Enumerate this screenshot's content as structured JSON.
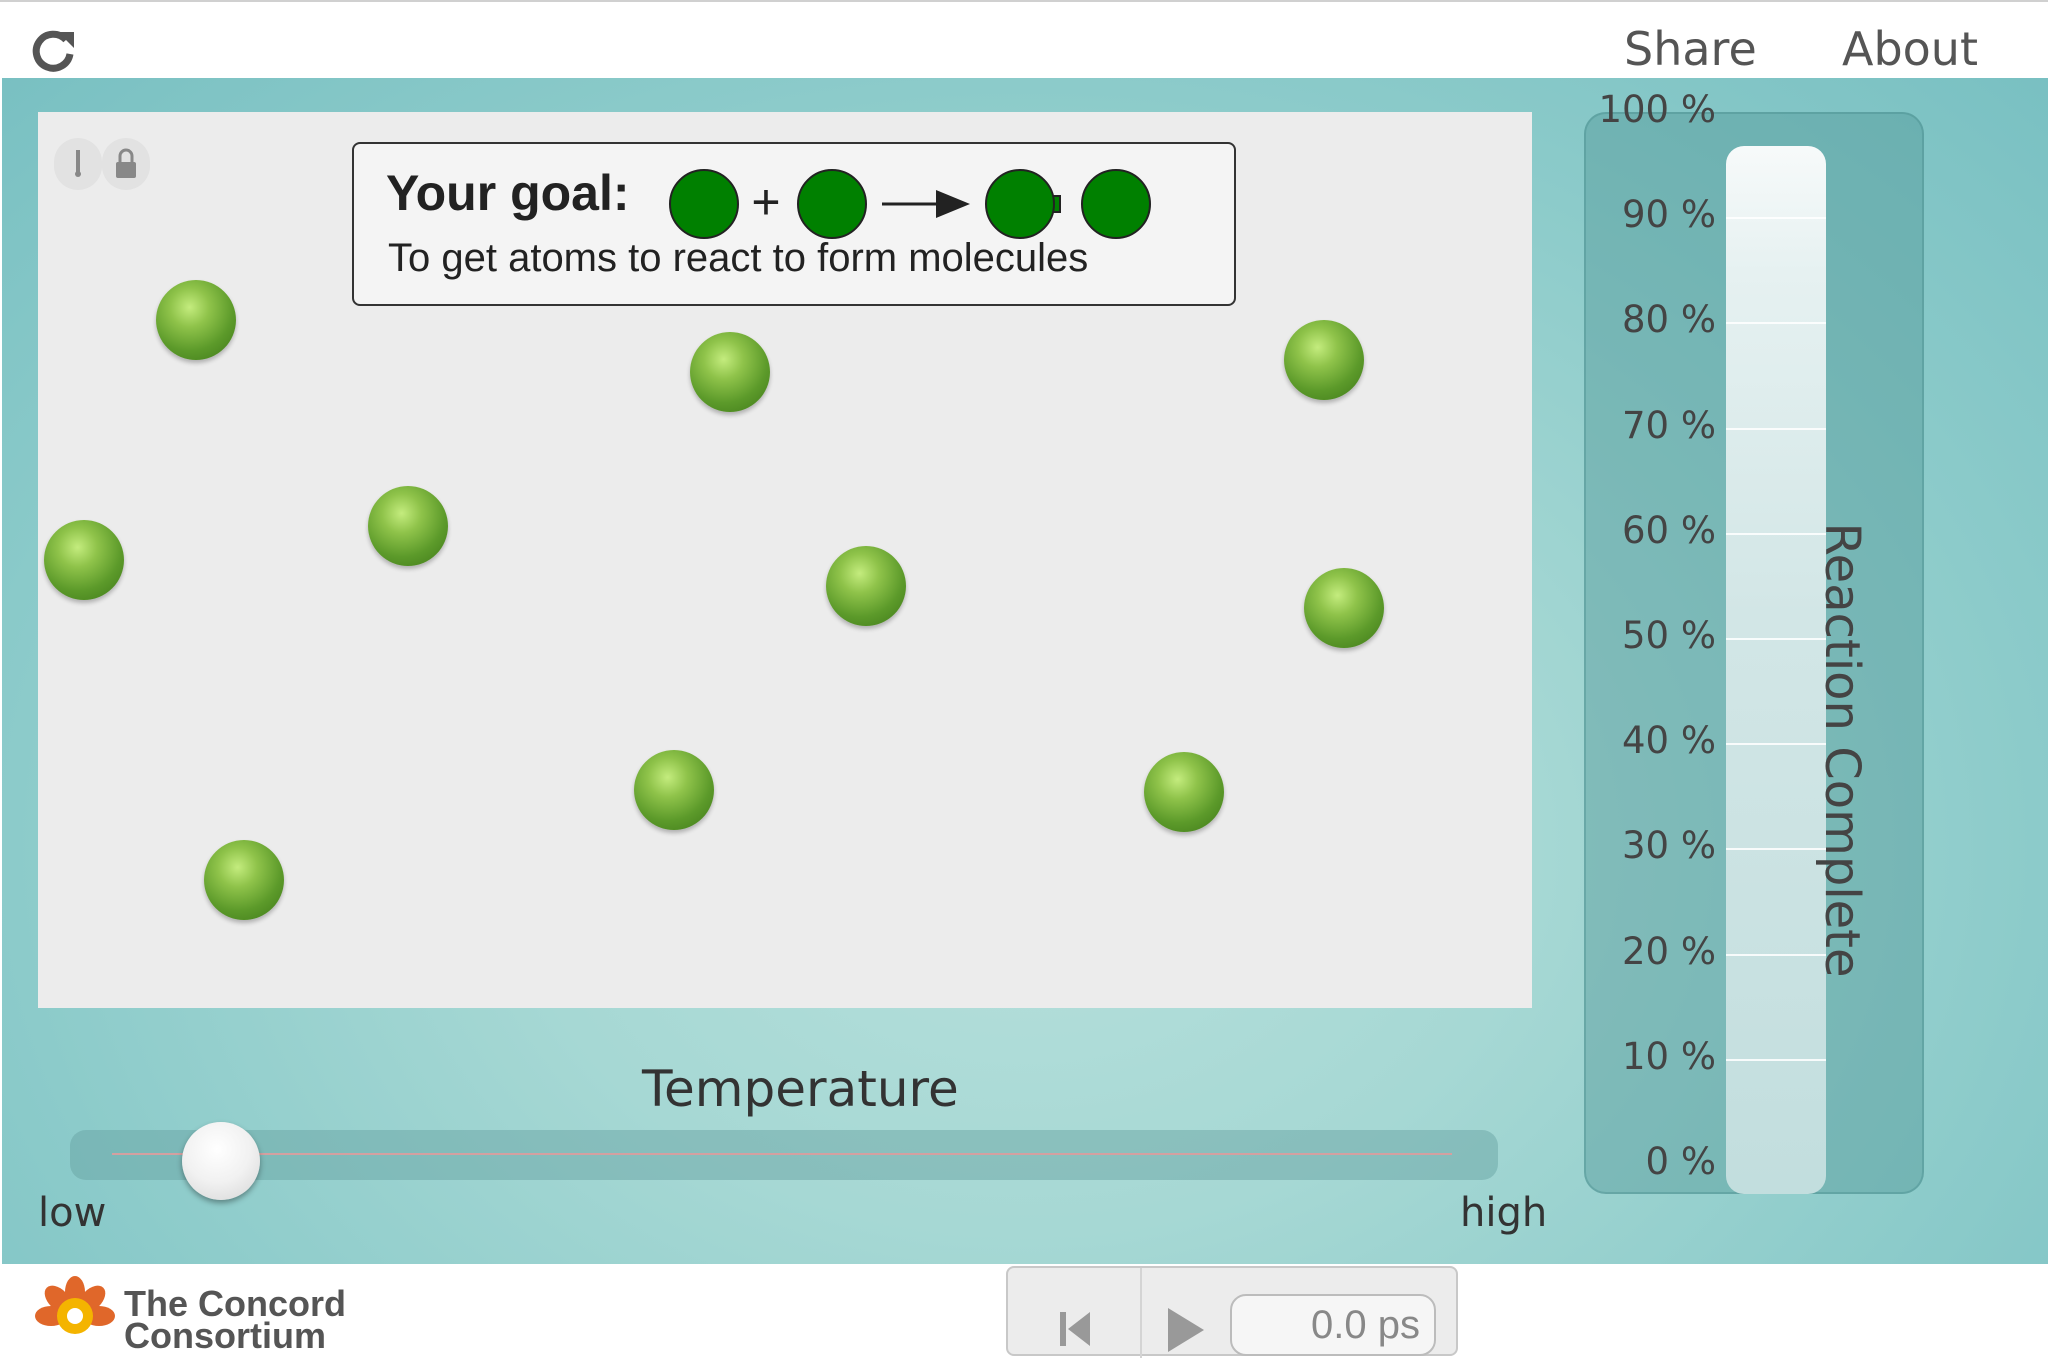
{
  "header": {
    "share_label": "Share",
    "about_label": "About"
  },
  "goal": {
    "title": "Your goal:",
    "description": "To get atoms to react to form molecules",
    "plus": "+"
  },
  "temperature": {
    "label": "Temperature",
    "low_label": "low",
    "high_label": "high",
    "value_fraction": 0.08
  },
  "meter": {
    "title": "Reaction Complete",
    "ticks": [
      "100 %",
      "90 %",
      "80 %",
      "70 %",
      "60 %",
      "50 %",
      "40 %",
      "30 %",
      "20 %",
      "10 %",
      "0 %"
    ],
    "value_percent": 0
  },
  "footer": {
    "logo_line1": "The Concord",
    "logo_line2": "Consortium"
  },
  "player": {
    "time": "0.0 ps"
  },
  "colors": {
    "atom": "#5c9a2a",
    "goal_atom": "#008000",
    "background": "#a6d8d4"
  },
  "icons": [
    "reload-icon",
    "thermometer-icon",
    "lock-icon",
    "rewind-icon",
    "play-icon"
  ]
}
